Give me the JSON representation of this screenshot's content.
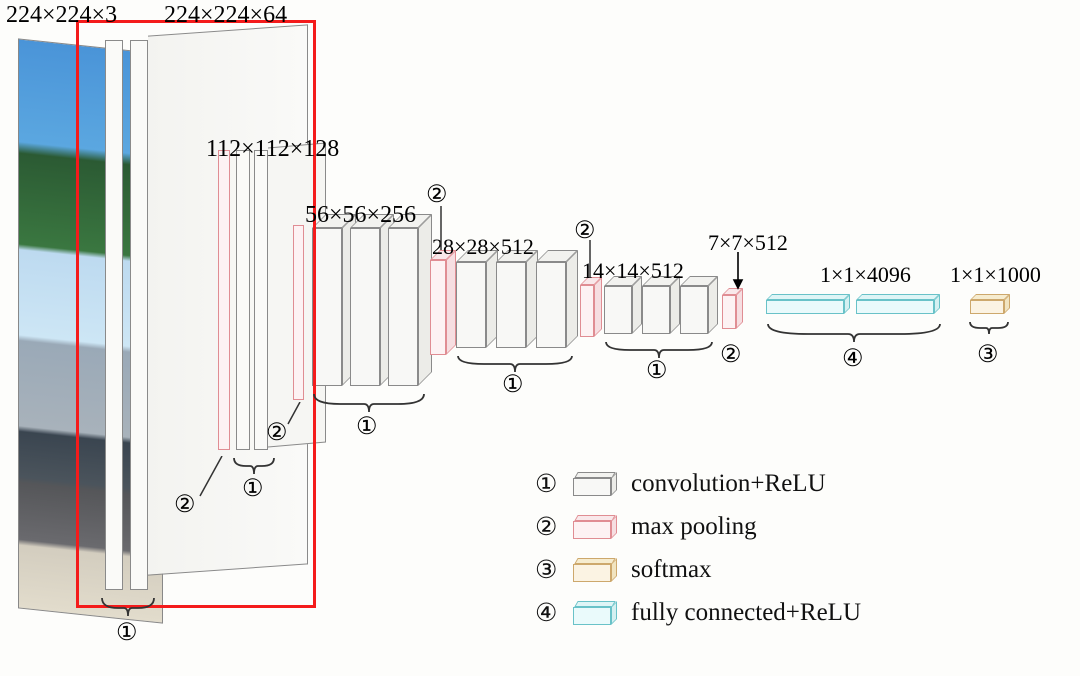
{
  "labels": {
    "input": "224×224×3",
    "conv1": "224×224×64",
    "conv2": "112×112×128",
    "conv3": "56×56×256",
    "conv4": "28×28×512",
    "conv5": "14×14×512",
    "pool5": "7×7×512",
    "fc": "1×1×4096",
    "out": "1×1×1000"
  },
  "markers": {
    "m1": "①",
    "m2": "②",
    "m3": "③",
    "m4": "④"
  },
  "legend": [
    {
      "num": "①",
      "swatch": "gray",
      "text": "convolution+ReLU"
    },
    {
      "num": "②",
      "swatch": "pink",
      "text": "max pooling"
    },
    {
      "num": "③",
      "swatch": "tan",
      "text": "softmax"
    },
    {
      "num": "④",
      "swatch": "teal",
      "text": "fully connected+ReLU"
    }
  ],
  "chart_data": {
    "type": "diagram",
    "title": "VGG-16 CNN architecture",
    "blocks": [
      {
        "name": "input",
        "dims": "224×224×3",
        "type": "image"
      },
      {
        "name": "conv1",
        "dims": "224×224×64",
        "type": "convolution+ReLU",
        "layers": 2
      },
      {
        "name": "pool1",
        "type": "max pooling"
      },
      {
        "name": "conv2",
        "dims": "112×112×128",
        "type": "convolution+ReLU",
        "layers": 2
      },
      {
        "name": "pool2",
        "type": "max pooling"
      },
      {
        "name": "conv3",
        "dims": "56×56×256",
        "type": "convolution+ReLU",
        "layers": 3
      },
      {
        "name": "pool3",
        "type": "max pooling"
      },
      {
        "name": "conv4",
        "dims": "28×28×512",
        "type": "convolution+ReLU",
        "layers": 3
      },
      {
        "name": "pool4",
        "type": "max pooling"
      },
      {
        "name": "conv5",
        "dims": "14×14×512",
        "type": "convolution+ReLU",
        "layers": 3
      },
      {
        "name": "pool5",
        "dims": "7×7×512",
        "type": "max pooling"
      },
      {
        "name": "fc",
        "dims": "1×1×4096",
        "type": "fully connected+ReLU",
        "layers": 2
      },
      {
        "name": "out",
        "dims": "1×1×1000",
        "type": "softmax"
      }
    ],
    "legend_markers": {
      "①": "convolution+ReLU",
      "②": "max pooling",
      "③": "softmax",
      "④": "fully connected+ReLU"
    },
    "highlighted_region": "input image + first two 224×224×64 conv layers (red rectangle)"
  }
}
